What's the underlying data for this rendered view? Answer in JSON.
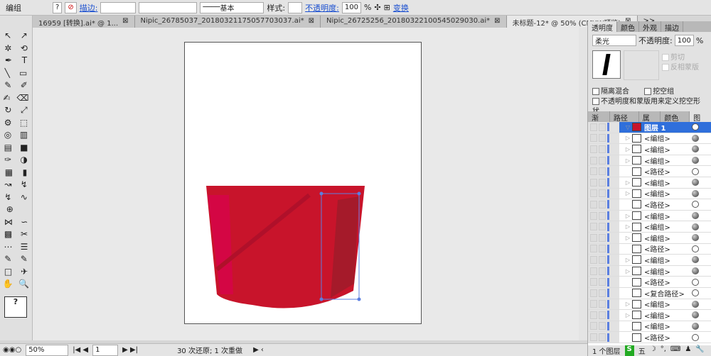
{
  "control_bar": {
    "selection_label": "编组",
    "fill_value": "?",
    "stroke_label": "描边:",
    "stroke_profile": "基本",
    "style_label": "样式:",
    "opacity_label": "不透明度:",
    "opacity_value": "100",
    "percent": "%",
    "transform_label": "变换"
  },
  "doc_tabs": [
    {
      "label": "16959 [转换].ai* @ 1...",
      "active": false
    },
    {
      "label": "Nipic_26785037_20180321175057703037.ai*",
      "active": false
    },
    {
      "label": "Nipic_26725256_20180322100545029030.ai*",
      "active": false
    },
    {
      "label": "未标题-12* @ 50% (CMYK/预览)",
      "active": true
    }
  ],
  "tab_overflow": ">>",
  "tools": [
    [
      "↖",
      "↗"
    ],
    [
      "✲",
      "⟲"
    ],
    [
      "✒",
      "T"
    ],
    [
      "╲",
      "▭"
    ],
    [
      "✎",
      "✐"
    ],
    [
      "✍",
      "⌫"
    ],
    [
      "↻",
      "⤢"
    ],
    [
      "⚙",
      "⬚"
    ],
    [
      "◎",
      "▥"
    ],
    [
      "▤",
      "■"
    ],
    [
      "✑",
      "◑"
    ],
    [
      "▦",
      "▮"
    ],
    [
      "↝",
      "↯"
    ],
    [
      "↯",
      "∿"
    ],
    [
      "⊕",
      ""
    ],
    [
      "⋈",
      "∽"
    ],
    [
      "▩",
      "✂"
    ],
    [
      "⋯",
      "☰"
    ],
    [
      "✎",
      "✎"
    ],
    [
      "□",
      "✈"
    ],
    [
      "✋",
      "🔍"
    ]
  ],
  "transparency_panel": {
    "tabs": [
      "透明度",
      "颜色",
      "外观",
      "描边"
    ],
    "blend_mode": "柔光",
    "opacity_label": "不透明度:",
    "opacity_value": "100",
    "percent": "%",
    "clip_label": "剪切",
    "invert_mask_label": "反相蒙版",
    "isolate_blending": "隔离混合",
    "knockout_group": "挖空组",
    "opacity_mask_knockout": "不透明度和蒙版用来定义挖空形状"
  },
  "layers_panel": {
    "tabs": [
      "渐变",
      "路径查",
      "属性",
      "颜色参",
      "图层"
    ],
    "rows": [
      {
        "name": "图层 1",
        "selected": true,
        "expander": "▽",
        "target": "o"
      },
      {
        "name": "<编组>",
        "expander": "▷",
        "target": "f"
      },
      {
        "name": "<编组>",
        "expander": "▷",
        "target": "f"
      },
      {
        "name": "<编组>",
        "expander": "▷",
        "target": "f"
      },
      {
        "name": "<路径>",
        "expander": "",
        "target": "o"
      },
      {
        "name": "<编组>",
        "expander": "▷",
        "target": "f"
      },
      {
        "name": "<编组>",
        "expander": "▷",
        "target": "f"
      },
      {
        "name": "<路径>",
        "expander": "",
        "target": "o"
      },
      {
        "name": "<编组>",
        "expander": "▷",
        "target": "f"
      },
      {
        "name": "<编组>",
        "expander": "▷",
        "target": "f"
      },
      {
        "name": "<编组>",
        "expander": "▷",
        "target": "f"
      },
      {
        "name": "<路径>",
        "expander": "",
        "target": "o"
      },
      {
        "name": "<编组>",
        "expander": "▷",
        "target": "f"
      },
      {
        "name": "<编组>",
        "expander": "▷",
        "target": "f"
      },
      {
        "name": "<路径>",
        "expander": "",
        "target": "o"
      },
      {
        "name": "<复合路径>",
        "expander": "",
        "target": "o"
      },
      {
        "name": "<编组>",
        "expander": "▷",
        "target": "f"
      },
      {
        "name": "<编组>",
        "expander": "▷",
        "target": "f"
      },
      {
        "name": "<编组>",
        "expander": "",
        "target": "f"
      },
      {
        "name": "<路径>",
        "expander": "",
        "target": "o"
      }
    ],
    "footer": "1 个图层"
  },
  "status_bar": {
    "zoom": "50%",
    "page": "1",
    "history": "30 次还原; 1 次重做"
  },
  "ime_bar": [
    "S",
    "五",
    "☽",
    "°,",
    "⌨",
    "♟",
    "🔧"
  ],
  "colors": {
    "artwork_red": "#c8142b",
    "selection_blue": "#5b7fe0",
    "layer_selected": "#2f6fdb"
  }
}
